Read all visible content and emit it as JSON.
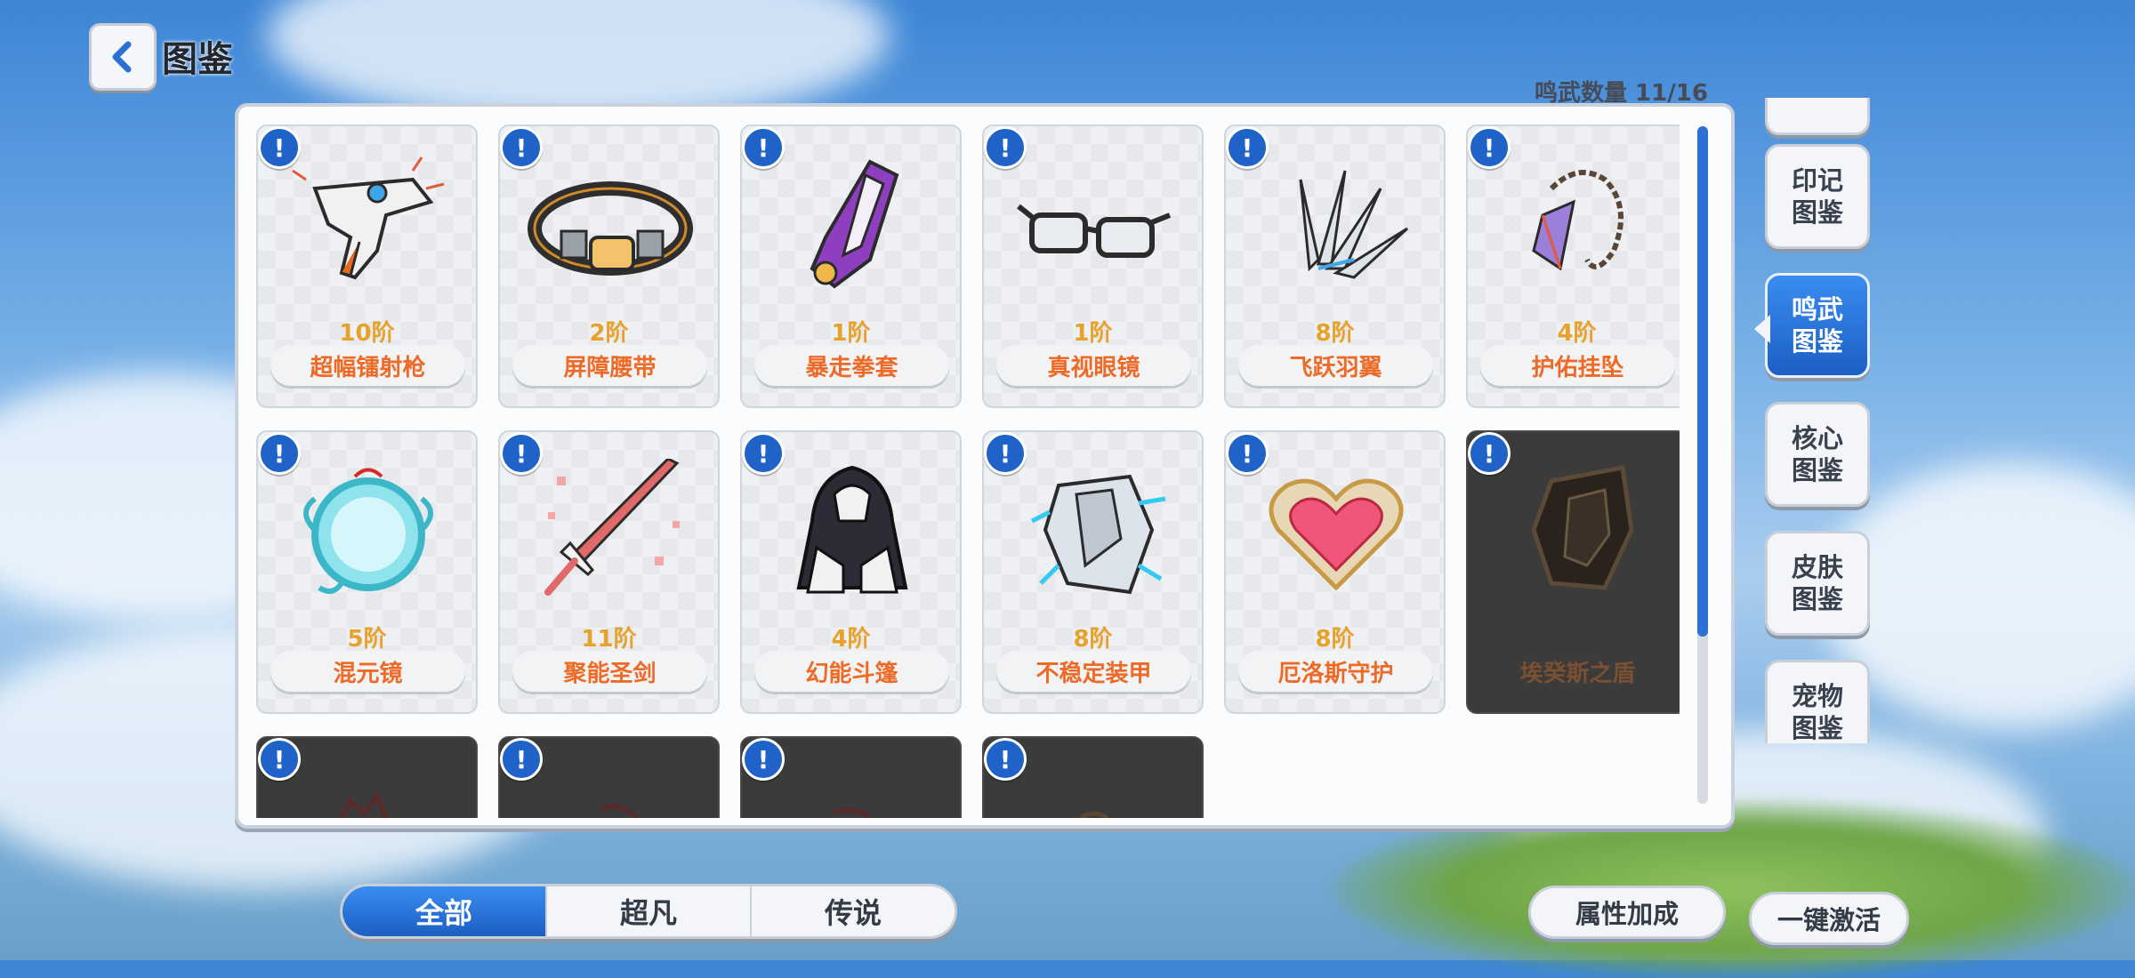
{
  "header": {
    "title": "图鉴"
  },
  "collection": {
    "count_label": "鸣武数量 11/16"
  },
  "cards": [
    {
      "grade": "10阶",
      "name": "超幅镭射枪",
      "locked": false,
      "icon": "laser-gun-icon"
    },
    {
      "grade": "2阶",
      "name": "屏障腰带",
      "locked": false,
      "icon": "belt-icon"
    },
    {
      "grade": "1阶",
      "name": "暴走拳套",
      "locked": false,
      "icon": "gauntlet-icon"
    },
    {
      "grade": "1阶",
      "name": "真视眼镜",
      "locked": false,
      "icon": "glasses-icon"
    },
    {
      "grade": "8阶",
      "name": "飞跃羽翼",
      "locked": false,
      "icon": "wings-icon"
    },
    {
      "grade": "4阶",
      "name": "护佑挂坠",
      "locked": false,
      "icon": "pendant-icon"
    },
    {
      "grade": "5阶",
      "name": "混元镜",
      "locked": false,
      "icon": "mirror-icon"
    },
    {
      "grade": "11阶",
      "name": "聚能圣剑",
      "locked": false,
      "icon": "sword-icon"
    },
    {
      "grade": "4阶",
      "name": "幻能斗篷",
      "locked": false,
      "icon": "cloak-icon"
    },
    {
      "grade": "8阶",
      "name": "不稳定装甲",
      "locked": false,
      "icon": "armor-icon"
    },
    {
      "grade": "8阶",
      "name": "厄洛斯守护",
      "locked": false,
      "icon": "heart-icon"
    },
    {
      "grade": "",
      "name": "埃癸斯之盾",
      "locked": true,
      "icon": "shield-icon"
    },
    {
      "grade": "",
      "name": "",
      "locked": true,
      "icon": "locked-item-icon"
    },
    {
      "grade": "",
      "name": "",
      "locked": true,
      "icon": "locked-item-icon"
    },
    {
      "grade": "",
      "name": "",
      "locked": true,
      "icon": "locked-item-icon"
    },
    {
      "grade": "",
      "name": "",
      "locked": true,
      "icon": "locked-item-icon"
    }
  ],
  "side_tabs": [
    {
      "label_line1": "印记",
      "label_line2": "图鉴",
      "active": false
    },
    {
      "label_line1": "鸣武",
      "label_line2": "图鉴",
      "active": true
    },
    {
      "label_line1": "核心",
      "label_line2": "图鉴",
      "active": false
    },
    {
      "label_line1": "皮肤",
      "label_line2": "图鉴",
      "active": false
    },
    {
      "label_line1": "宠物",
      "label_line2": "图鉴",
      "active": false
    }
  ],
  "filters": [
    {
      "label": "全部",
      "active": true
    },
    {
      "label": "超凡",
      "active": false
    },
    {
      "label": "传说",
      "active": false
    }
  ],
  "buttons": {
    "attribute_bonus": "属性加成",
    "one_click_activate": "一键激活"
  },
  "colors": {
    "accent": "#1f63c9",
    "grade": "#e6a22b",
    "name": "#ee6a27"
  }
}
